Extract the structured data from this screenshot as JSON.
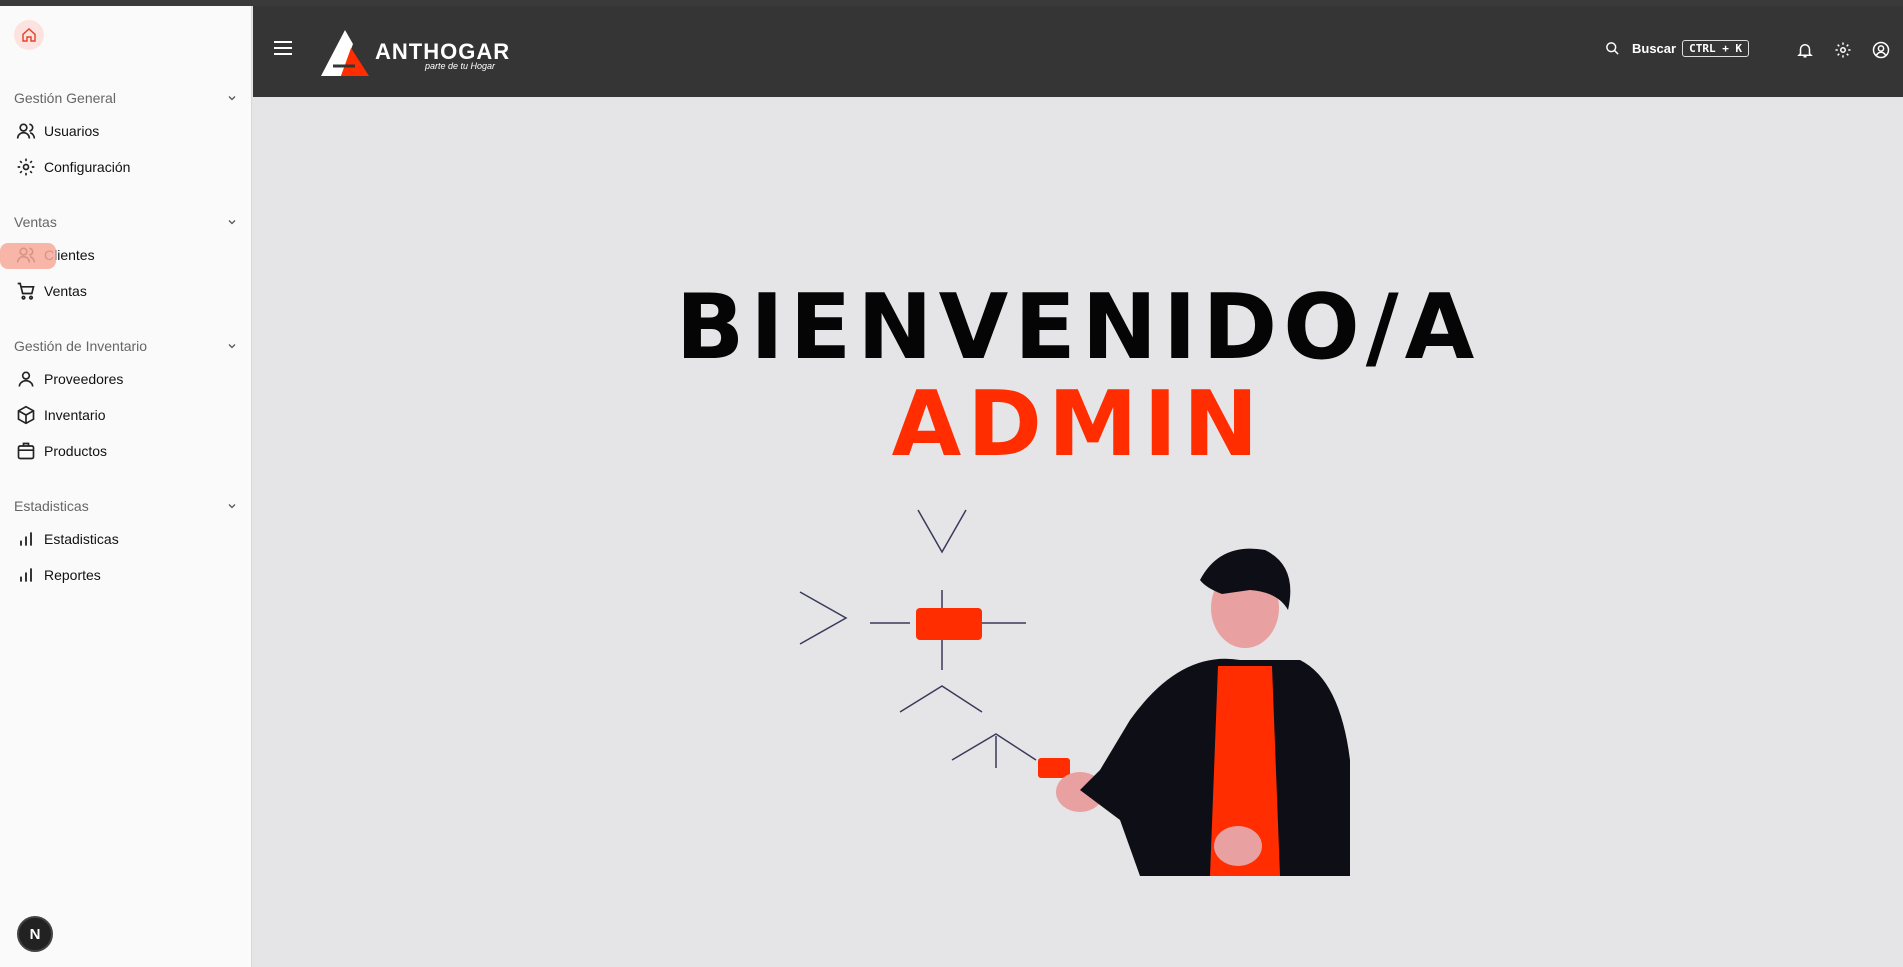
{
  "colors": {
    "accent": "#ff2d00",
    "header": "#353535",
    "sidebar": "#fafafa",
    "content": "#e5e5e7"
  },
  "sidebar": {
    "groups": [
      {
        "title": "Gestión General",
        "items": [
          {
            "label": "Usuarios",
            "icon": "users-icon"
          },
          {
            "label": "Configuración",
            "icon": "gear-icon"
          }
        ]
      },
      {
        "title": "Ventas",
        "items": [
          {
            "label": "Clientes",
            "icon": "users-icon"
          },
          {
            "label": "Ventas",
            "icon": "cart-icon"
          }
        ]
      },
      {
        "title": "Gestión de Inventario",
        "items": [
          {
            "label": "Proveedores",
            "icon": "user-icon"
          },
          {
            "label": "Inventario",
            "icon": "box-icon"
          },
          {
            "label": "Productos",
            "icon": "package-icon"
          }
        ]
      },
      {
        "title": "Estadisticas",
        "items": [
          {
            "label": "Estadisticas",
            "icon": "bar-chart-icon"
          },
          {
            "label": "Reportes",
            "icon": "bar-chart-icon"
          }
        ]
      }
    ],
    "footer_badge": "N"
  },
  "header": {
    "brand": "ANTHOGAR",
    "tagline": "parte de tu Hogar",
    "search_label": "Buscar",
    "shortcut": "CTRL + K"
  },
  "main": {
    "welcome": "BIENVENIDO/A",
    "role": "ADMIN"
  }
}
